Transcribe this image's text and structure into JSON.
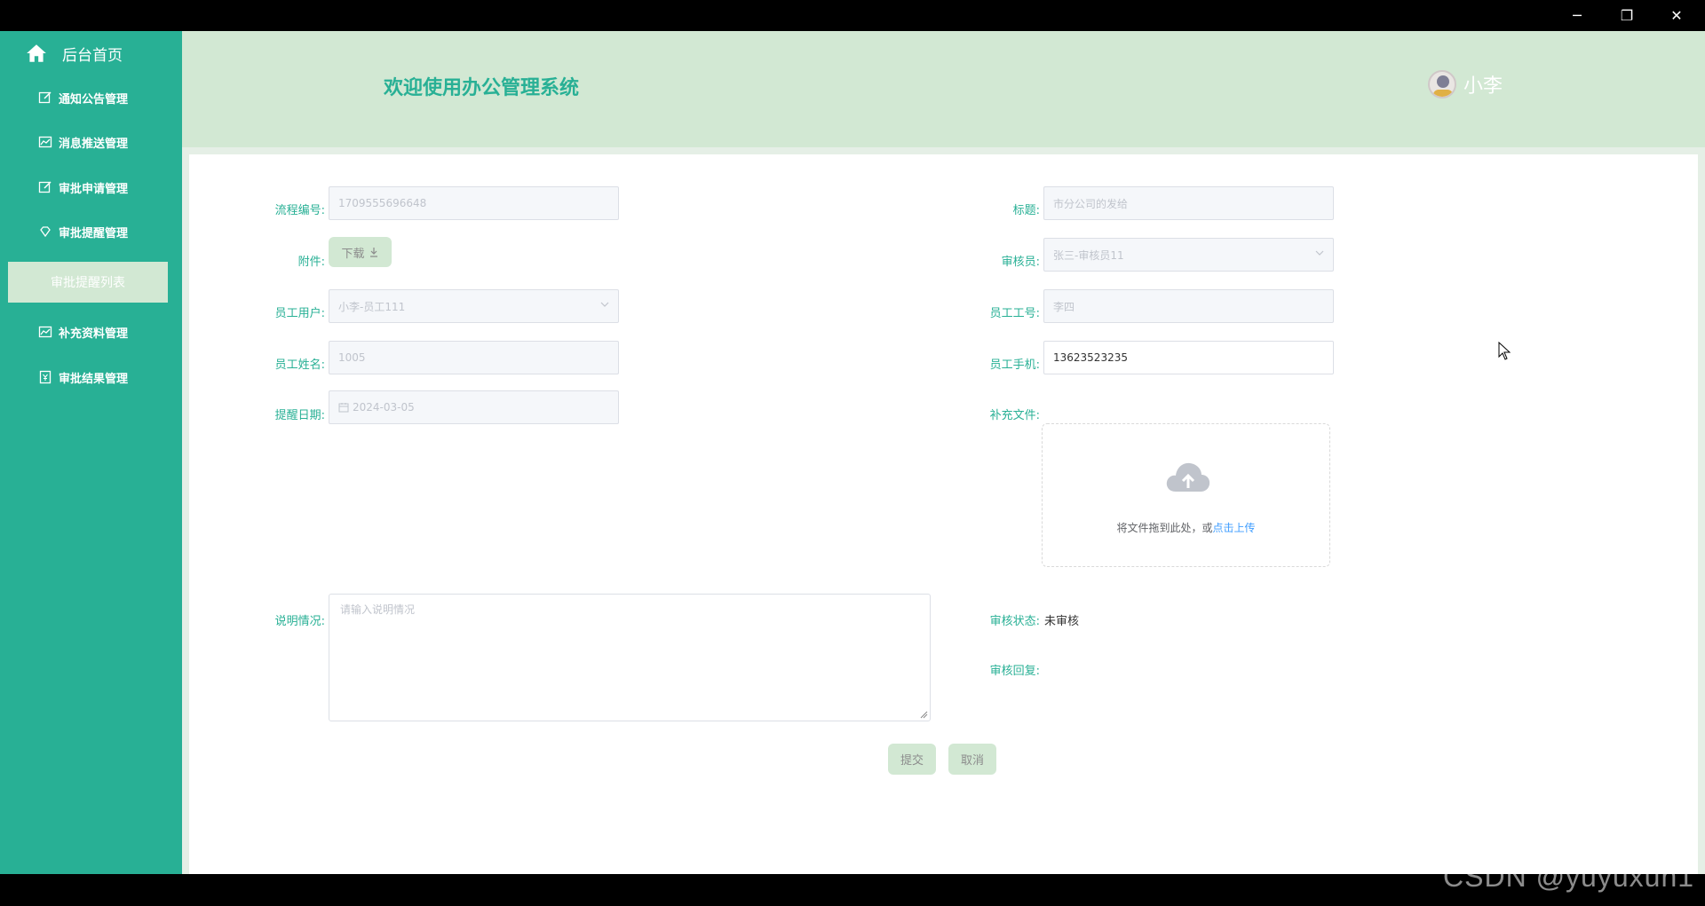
{
  "window": {
    "minimize": "─",
    "maximize": "❐",
    "close": "✕"
  },
  "sidebar": {
    "home_label": "后台首页",
    "items": [
      {
        "label": "通知公告管理",
        "icon": "edit-icon"
      },
      {
        "label": "消息推送管理",
        "icon": "chart-icon"
      },
      {
        "label": "审批申请管理",
        "icon": "edit-icon"
      },
      {
        "label": "审批提醒管理",
        "icon": "diamond-icon"
      },
      {
        "label": "补充资料管理",
        "icon": "chart-icon"
      },
      {
        "label": "审批结果管理",
        "icon": "money-icon"
      }
    ],
    "active_sub": "审批提醒列表"
  },
  "header": {
    "title": "欢迎使用办公管理系统",
    "username": "小李"
  },
  "form": {
    "flow_no": {
      "label": "流程编号:",
      "value": "1709555696648"
    },
    "title": {
      "label": "标题:",
      "value": "市分公司的发给"
    },
    "attachment": {
      "label": "附件:",
      "button": "下载"
    },
    "reviewer": {
      "label": "审核员:",
      "value": "张三-审核员11"
    },
    "employee_user": {
      "label": "员工用户:",
      "value": "小李-员工111"
    },
    "employee_id": {
      "label": "员工工号:",
      "value": "李四"
    },
    "employee_name": {
      "label": "员工姓名:",
      "value": "1005"
    },
    "employee_phone": {
      "label": "员工手机:",
      "value": "13623523235"
    },
    "remind_date": {
      "label": "提醒日期:",
      "value": "2024-03-05"
    },
    "supplement_file": {
      "label": "补充文件:",
      "hint": "将文件拖到此处，或",
      "link": "点击上传"
    },
    "description": {
      "label": "说明情况:",
      "placeholder": "请输入说明情况"
    },
    "review_status": {
      "label": "审核状态:",
      "value": "未审核"
    },
    "review_reply": {
      "label": "审核回复:",
      "value": ""
    },
    "submit": "提交",
    "cancel": "取消"
  },
  "watermark": "CSDN @yuyuxun1",
  "colors": {
    "accent": "#28b095",
    "light": "#d2e8d3",
    "link": "#409eff"
  }
}
